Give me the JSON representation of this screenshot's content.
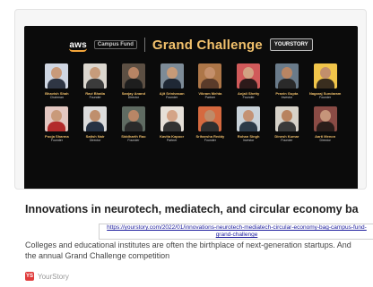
{
  "banner": {
    "aws_text": "aws",
    "campus_text": "Campus Fund",
    "title": "Grand Challenge",
    "logo_text": "YOURSTORY",
    "row1": [
      {
        "name": "Bhavish Shah",
        "role": "Chairman",
        "colors": {
          "bg": "#cfd6e2",
          "skin": "#c89a7a",
          "cloth": "#2f3644"
        }
      },
      {
        "name": "Ravi Bhatia",
        "role": "Founder",
        "colors": {
          "bg": "#dcd7cf",
          "skin": "#c79c7b",
          "cloth": "#3b3b3b"
        }
      },
      {
        "name": "Sanjay Anand",
        "role": "Director",
        "colors": {
          "bg": "#5c4f43",
          "skin": "#b88464",
          "cloth": "#1e1e1e"
        }
      },
      {
        "name": "Ajit Srinivasan",
        "role": "Founder",
        "colors": {
          "bg": "#7d8b97",
          "skin": "#c69a78",
          "cloth": "#1f2835"
        }
      },
      {
        "name": "Vikram Mehta",
        "role": "Partner",
        "colors": {
          "bg": "#ad7648",
          "skin": "#c48f6b",
          "cloth": "#5a3b2a"
        }
      },
      {
        "name": "Anjali Shetty",
        "role": "Founder",
        "colors": {
          "bg": "#d15a5a",
          "skin": "#d2a283",
          "cloth": "#2d1a1a"
        }
      },
      {
        "name": "Pravin Gupta",
        "role": "Investor",
        "colors": {
          "bg": "#6a7b8a",
          "skin": "#b88563",
          "cloth": "#2a2a2a"
        }
      },
      {
        "name": "Nagaraj Sundaram",
        "role": "Founder",
        "colors": {
          "bg": "#f1c54a",
          "skin": "#c28f6c",
          "cloth": "#3a2e1f"
        }
      }
    ],
    "row2": [
      {
        "name": "Pooja Sharma",
        "role": "Founder",
        "colors": {
          "bg": "#e3c7c1",
          "skin": "#c99a7a",
          "cloth": "#b22b2b"
        }
      },
      {
        "name": "Satish Nair",
        "role": "Director",
        "colors": {
          "bg": "#dcdcdc",
          "skin": "#bf8f6d",
          "cloth": "#263244"
        }
      },
      {
        "name": "Siddharth Rao",
        "role": "Founder",
        "colors": {
          "bg": "#5f6b62",
          "skin": "#b88666",
          "cloth": "#2a2a2a"
        }
      },
      {
        "name": "Kavita Kapoor",
        "role": "Partner",
        "colors": {
          "bg": "#e6e0d8",
          "skin": "#d4a487",
          "cloth": "#333333"
        }
      },
      {
        "name": "Sriharsha Reddy",
        "role": "Founder",
        "colors": {
          "bg": "#d5693f",
          "skin": "#be8b69",
          "cloth": "#2f2f2f"
        }
      },
      {
        "name": "Rohan Singh",
        "role": "Investor",
        "colors": {
          "bg": "#c9d2d9",
          "skin": "#c49274",
          "cloth": "#2c3a48"
        }
      },
      {
        "name": "Dinesh Kumar",
        "role": "Founder",
        "colors": {
          "bg": "#d7d2c9",
          "skin": "#b8835f",
          "cloth": "#3a3a3a"
        }
      },
      {
        "name": "Aarti Menon",
        "role": "Director",
        "colors": {
          "bg": "#8a4b45",
          "skin": "#c6957a",
          "cloth": "#2a1d1a"
        }
      }
    ]
  },
  "card": {
    "badge_text": "YS",
    "title": "Innovations in neurotech, mediatech, and circular economy ba",
    "url_tooltip": "https://yourstory.com/2022/01/innovations-neurotech-mediatech-circular-economy-bag-campus-fund-grand-challenge",
    "description": "Colleges and educational institutes are often the birthplace of next-generation startups. And the annual Grand Challenge competition",
    "source_icon": "YS",
    "source_name": "YourStory"
  },
  "colors": {
    "banner_bg": "#0b0b0b",
    "accent_gold": "#f2c16c",
    "brand_red": "#e03b3b"
  }
}
